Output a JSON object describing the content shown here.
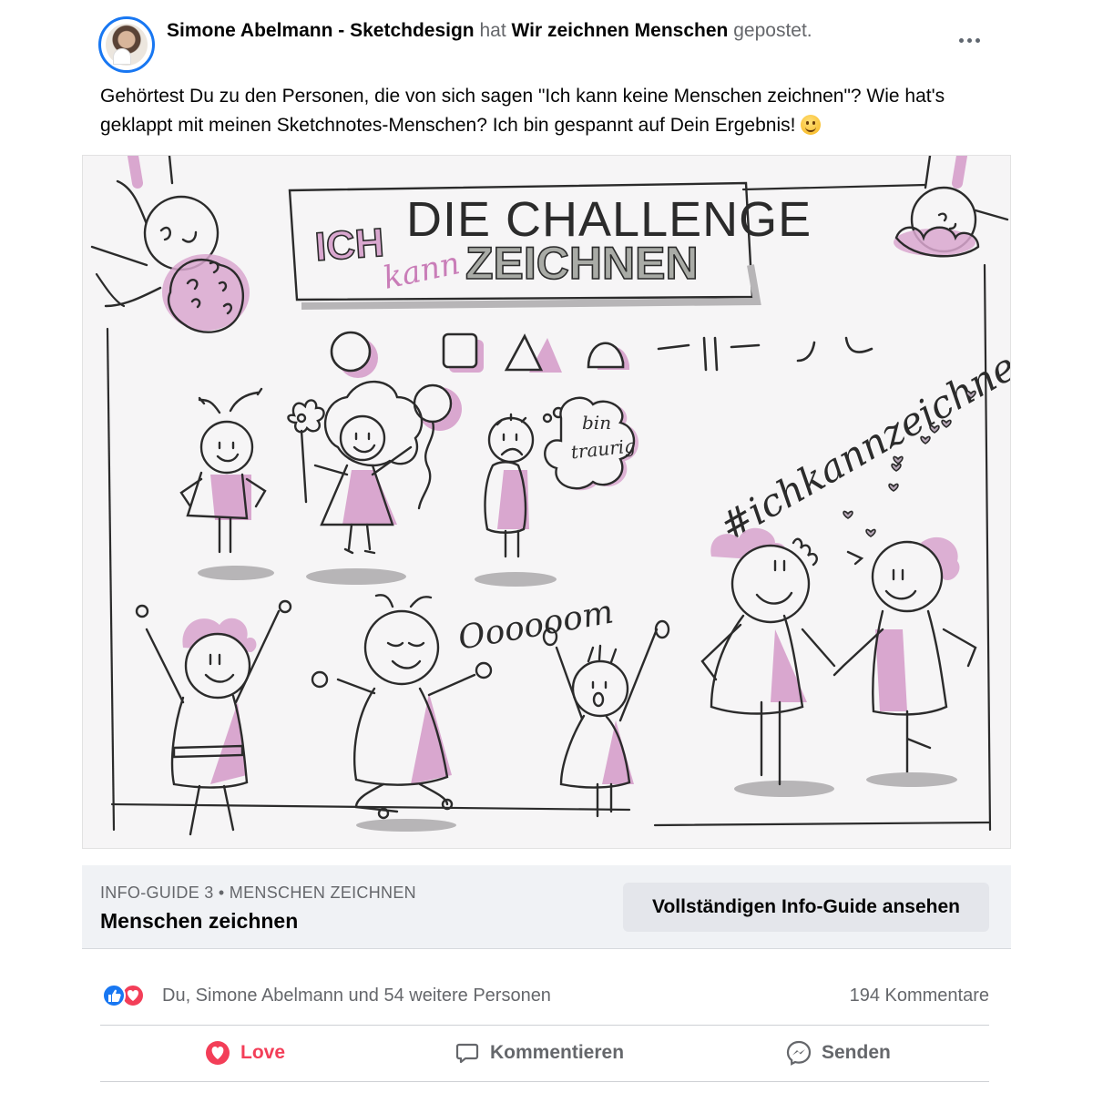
{
  "post": {
    "author": "Simone Abelmann - Sketchdesign",
    "verb": "hat",
    "group": "Wir zeichnen Menschen",
    "action": "gepostet.",
    "text": "Gehörtest Du zu den Personen, die von sich sagen \"Ich kann keine Menschen zeichnen\"? Wie hat's geklappt mit meinen Sketchnotes-Menschen? Ich bin gespannt auf Dein Ergebnis!",
    "emoji_icon": "smiling-face-icon",
    "more_icon": "more-options-icon"
  },
  "image": {
    "title_line": "DIE CHALLENGE",
    "word_ich": "ICH",
    "word_kann": "kann",
    "word_zeichnen": "ZEICHNEN",
    "bubble_1": "bin",
    "bubble_2": "traurig",
    "hashtag": "#ichkannzeichnen",
    "ooom": "Oooooom",
    "colors": {
      "pink": "#d9a7cf",
      "grey": "#b7b5b7",
      "ink": "#2b2b2b",
      "paper": "#f6f5f6"
    }
  },
  "guide": {
    "kicker": "INFO-GUIDE 3 • MENSCHEN ZEICHNEN",
    "title": "Menschen zeichnen",
    "button": "Vollständigen Info-Guide ansehen"
  },
  "stats": {
    "reactions": "Du, Simone Abelmann und 54 weitere Personen",
    "comments": "194 Kommentare"
  },
  "actions": {
    "love": "Love",
    "comment": "Kommentieren",
    "send": "Senden"
  },
  "theme": {
    "accent": "#1877f2",
    "love": "#f33e58",
    "muted": "#65676b"
  }
}
